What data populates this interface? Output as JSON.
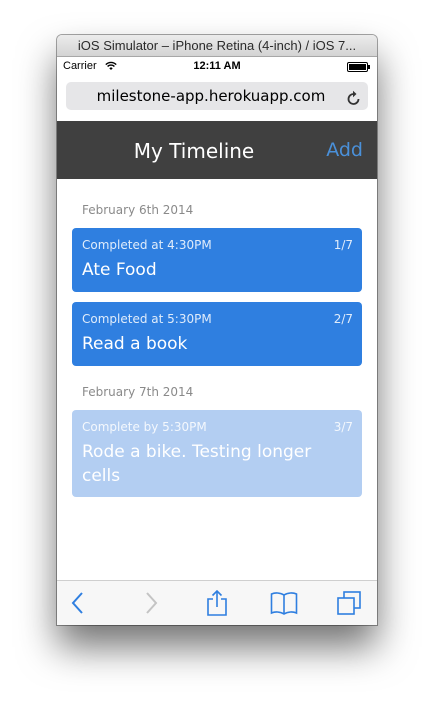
{
  "window": {
    "title": "iOS Simulator – iPhone Retina (4-inch) / iOS 7..."
  },
  "statusbar": {
    "carrier": "Carrier",
    "time": "12:11 AM"
  },
  "browser": {
    "url": "milestone-app.herokuapp.com"
  },
  "app": {
    "title": "My Timeline",
    "add_label": "Add"
  },
  "timeline": {
    "groups": [
      {
        "date": "February 6th 2014",
        "items": [
          {
            "meta": "Completed at 4:30PM",
            "count": "1/7",
            "title": "Ate Food",
            "status": "completed"
          },
          {
            "meta": "Completed at 5:30PM",
            "count": "2/7",
            "title": "Read a book",
            "status": "completed"
          }
        ]
      },
      {
        "date": "February 7th 2014",
        "items": [
          {
            "meta": "Complete by 5:30PM",
            "count": "3/7",
            "title": "Rode a bike. Testing longer cells",
            "status": "pending"
          }
        ]
      }
    ]
  },
  "toolbar": {
    "icons": [
      "back-icon",
      "forward-icon",
      "share-icon",
      "bookmarks-icon",
      "tabs-icon"
    ]
  },
  "colors": {
    "accent": "#4a90d9",
    "nav_bg": "#404040",
    "card_completed": "#2f7fe0",
    "card_pending": "#b3cef2",
    "toolbar_icon": "#2f7fe0"
  }
}
